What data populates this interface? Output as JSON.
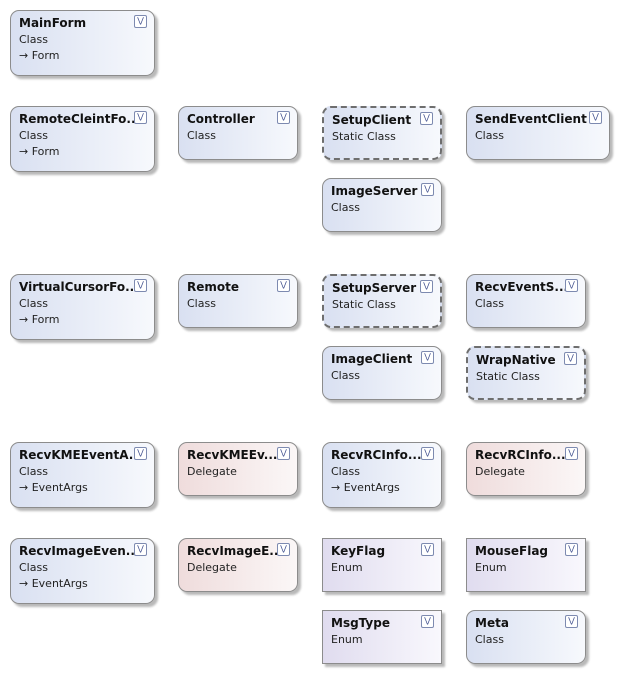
{
  "shapes": [
    {
      "name": "MainForm",
      "kind": "Class",
      "base": "→ Form",
      "style": "class"
    },
    {
      "name": "RemoteCleintFo...",
      "kind": "Class",
      "base": "→ Form",
      "style": "class"
    },
    {
      "name": "Controller",
      "kind": "Class",
      "style": "class"
    },
    {
      "name": "SetupClient",
      "kind": "Static Class",
      "style": "static"
    },
    {
      "name": "SendEventClient",
      "kind": "Class",
      "style": "class"
    },
    {
      "name": "ImageServer",
      "kind": "Class",
      "style": "class"
    },
    {
      "name": "VirtualCursorFo...",
      "kind": "Class",
      "base": "→ Form",
      "style": "class"
    },
    {
      "name": "Remote",
      "kind": "Class",
      "style": "class"
    },
    {
      "name": "SetupServer",
      "kind": "Static Class",
      "style": "static"
    },
    {
      "name": "RecvEventS...",
      "kind": "Class",
      "style": "class"
    },
    {
      "name": "ImageClient",
      "kind": "Class",
      "style": "class"
    },
    {
      "name": "WrapNative",
      "kind": "Static Class",
      "style": "static"
    },
    {
      "name": "RecvKMEEventA...",
      "kind": "Class",
      "base": "→ EventArgs",
      "style": "class"
    },
    {
      "name": "RecvKMEEv...",
      "kind": "Delegate",
      "style": "delegate"
    },
    {
      "name": "RecvRCInfo...",
      "kind": "Class",
      "base": "→ EventArgs",
      "style": "class"
    },
    {
      "name": "RecvRCInfo...",
      "kind": "Delegate",
      "style": "delegate"
    },
    {
      "name": "RecvImageEven...",
      "kind": "Class",
      "base": "→ EventArgs",
      "style": "class"
    },
    {
      "name": "RecvImageE...",
      "kind": "Delegate",
      "style": "delegate"
    },
    {
      "name": "KeyFlag",
      "kind": "Enum",
      "style": "enum"
    },
    {
      "name": "MouseFlag",
      "kind": "Enum",
      "style": "enum"
    },
    {
      "name": "MsgType",
      "kind": "Enum",
      "style": "enum"
    },
    {
      "name": "Meta",
      "kind": "Class",
      "style": "class"
    }
  ],
  "toggle_icon": "double-chevron-down-icon"
}
